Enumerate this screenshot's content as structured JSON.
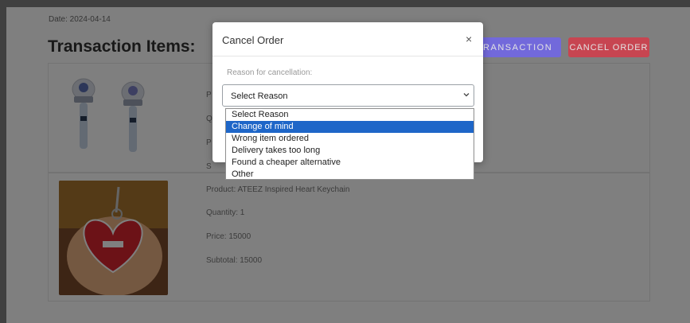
{
  "page": {
    "date": "Date: 2024-04-14",
    "title": "Transaction Items:",
    "transaction_button": "Transaction",
    "cancel_order_button": "Cancel Order"
  },
  "items": [
    {
      "product": "P",
      "quantity": "Q",
      "price": "P",
      "subtotal": "S"
    },
    {
      "product": "Product: ATEEZ Inspired Heart Keychain",
      "quantity": "Quantity: 1",
      "price": "Price: 15000",
      "subtotal": "Subtotal: 15000"
    }
  ],
  "modal": {
    "title": "Cancel Order",
    "close": "×",
    "reason_label": "Reason for cancellation:",
    "select_value": "Select Reason",
    "options": [
      "Select Reason",
      "Change of mind",
      "Wrong item ordered",
      "Delivery takes too long",
      "Found a cheaper alternative",
      "Other"
    ],
    "highlighted_option": "Change of mind"
  },
  "colors": {
    "transaction_button": "#6f63f5",
    "cancel_button": "#dc3545",
    "highlight": "#1e66c8"
  }
}
